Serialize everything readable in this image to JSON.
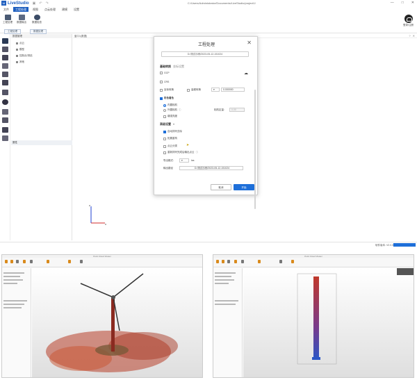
{
  "app": {
    "logo_glyph": "Li",
    "name": "LiveStudio",
    "title_path": "C:/Users/Administrator/Documents/LiveStudio/project1/",
    "window_controls": [
      "—",
      "□",
      "✕"
    ]
  },
  "menu": [
    {
      "label": "文件",
      "active": false
    },
    {
      "label": "工程处理",
      "active": true
    },
    {
      "label": "视图",
      "active": false
    },
    {
      "label": "点云处理",
      "active": false
    },
    {
      "label": "建模",
      "active": false
    },
    {
      "label": "设置",
      "active": false
    }
  ],
  "ribbon": {
    "buttons": [
      {
        "label": "工程处理",
        "icon": "gear-people-icon",
        "color": "#4a5a74"
      },
      {
        "label": "数据输出",
        "icon": "data-output-icon",
        "color": "#5c6a82"
      },
      {
        "label": "数据检查",
        "icon": "sparkle-icon",
        "color": "#3c4c66"
      }
    ],
    "groups": [
      "工程处理",
      "数据处理"
    ]
  },
  "user": {
    "label": "登录/注册",
    "icon": "user-icon"
  },
  "left_panel": {
    "title": "数据管理",
    "items": [
      "点云",
      "模型",
      "控制点/测站",
      "其他"
    ],
    "properties_title": "属性"
  },
  "viewport": {
    "tab": "窗口1(数据)",
    "icons": [
      "?",
      "✕"
    ]
  },
  "dialog": {
    "title": "工程处理",
    "path": "D:/测试示例/2023-05-12-151024",
    "section_basic": {
      "title": "基础转换",
      "sub": "坐标设置"
    },
    "opt_gcp": {
      "label": "GCP",
      "checked": false
    },
    "opt_crs": {
      "label": "CRS",
      "checked": false
    },
    "opt_coord": {
      "label": "坐标转换",
      "checked": false
    },
    "opt_elevation": {
      "label": "高程转换",
      "checked": false
    },
    "elevation_value": "0.000000",
    "section_color": {
      "label": "彩色着色",
      "checked": true
    },
    "radio_inner": {
      "label": "内置相机",
      "selected": true
    },
    "radio_outer": {
      "label": "外置相机",
      "selected": false
    },
    "camera_offset_label": "相机定量:",
    "camera_offset_value": "0.00",
    "opt_bright": {
      "label": "增强亮度",
      "checked": false
    },
    "section_advanced": {
      "title": "高级设置",
      "chev": "▾"
    },
    "adv_a": {
      "label": "自动排列去除",
      "checked": true
    },
    "adv_b": {
      "label": "拓展重构",
      "checked": false
    },
    "adv_c": {
      "label": "点云分类",
      "checked": false
    },
    "adv_d": {
      "label": "重新排列完成后输出点云",
      "checked": false
    },
    "output_format_label": "导出格式:",
    "output_format_value": "las",
    "output_path_label": "输出路径",
    "output_path_value": "D:/测试示例/2023-05-12-151024",
    "cancel": "取消",
    "ok": "开始"
  },
  "status": {
    "text": "软件版本: V2.0.0_x64"
  },
  "colors": {
    "accent": "#1e6fd9",
    "menu_active": "#1f5fbf"
  },
  "bottom_shots": [
    {
      "title": "Point Cloud Viewer",
      "content": "wind-turbine-point-cloud"
    },
    {
      "title": "Point Cloud Viewer",
      "content": "tower-point-cloud"
    }
  ]
}
